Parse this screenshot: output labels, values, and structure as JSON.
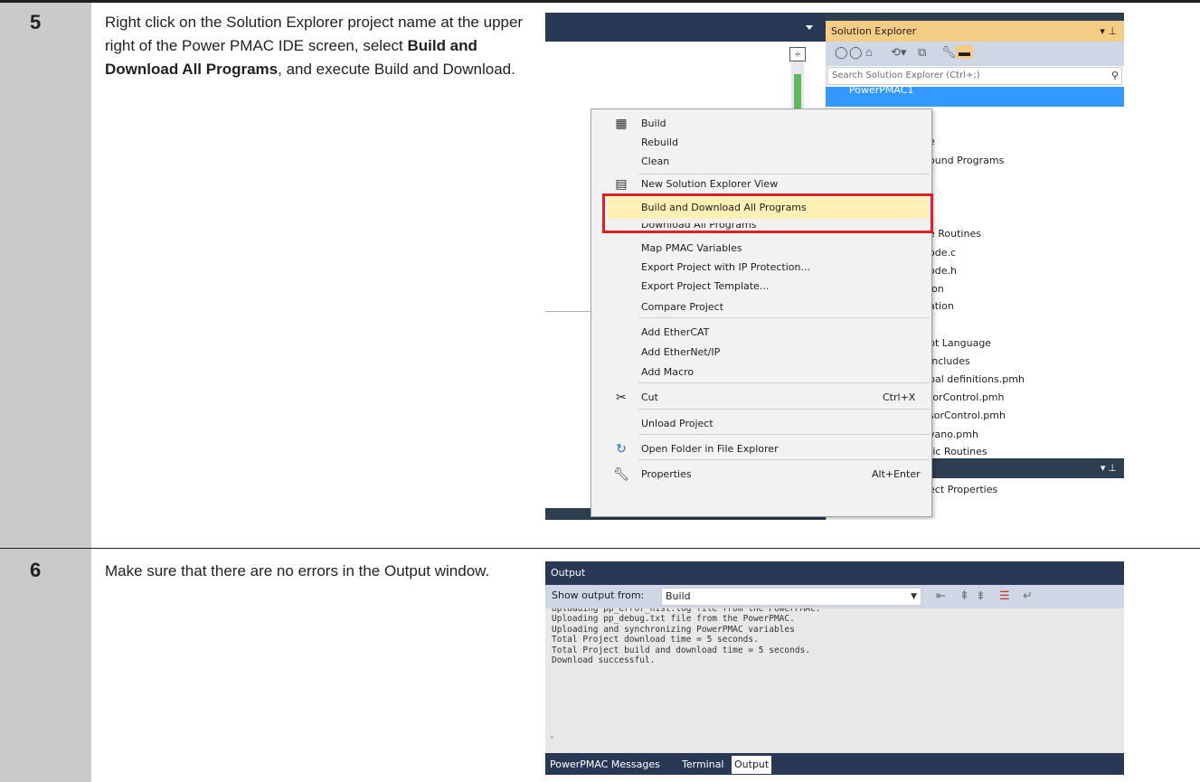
{
  "steps": [
    {
      "number": "5",
      "text_before": "Right click on the Solution Explorer project name at the upper right of the Power PMAC IDE screen, select ",
      "text_bold": "Build and Download All Programs",
      "text_after": ", and execute Build and Download."
    },
    {
      "number": "6",
      "text": "Make sure that there are no errors in the Output window."
    }
  ],
  "solution_explorer": {
    "title": "Solution Explorer",
    "search_placeholder": "Search Solution Explorer (Ctrl+;)",
    "selected_item": "PowerPMAC1",
    "items": [
      "e",
      "ound Programs",
      "s",
      "e Routines",
      "ode.c",
      "ode.h",
      "ion",
      "ation",
      "pt Language",
      "Includes",
      "bal definitions.pmh",
      "torControl.pmh",
      "sorControl.pmh",
      "vano.pmh",
      "tic Routines"
    ],
    "properties_row": "ect Properties"
  },
  "context_menu": {
    "items": [
      {
        "label": "Build",
        "icon": "build-icon"
      },
      {
        "label": "Rebuild"
      },
      {
        "label": "Clean"
      },
      {
        "label": "New Solution Explorer View",
        "icon": "new-view-icon"
      },
      {
        "label": "Build and Download All Programs",
        "highlighted": true
      },
      {
        "label": "Download All Programs"
      },
      {
        "label": "Map PMAC Variables"
      },
      {
        "label": "Export Project with IP Protection..."
      },
      {
        "label": "Export Project Template..."
      },
      {
        "label": "Compare Project"
      },
      {
        "label": "Add EtherCAT"
      },
      {
        "label": "Add EtherNet/IP"
      },
      {
        "label": "Add Macro"
      },
      {
        "label": "Cut",
        "shortcut": "Ctrl+X",
        "icon": "scissors-icon"
      },
      {
        "label": "Unload Project"
      },
      {
        "label": "Open Folder in File Explorer",
        "icon": "refresh-arrow-icon"
      },
      {
        "label": "Properties",
        "shortcut": "Alt+Enter",
        "icon": "wrench-icon"
      }
    ],
    "highlight_color": "#e02020"
  },
  "output_window": {
    "title": "Output",
    "show_output_label": "Show output from:",
    "source": "Build",
    "lines": [
      "Uploading pp_error_hist.log file from the PowerPMAC.",
      "Uploading pp_debug.txt file from the PowerPMAC.",
      "Uploading and synchronizing PowerPMAC variables",
      "Total Project download time = 5 seconds.",
      "Total Project build and download time = 5 seconds.",
      "Download successful."
    ],
    "tabs": [
      "PowerPMAC Messages",
      "Terminal",
      "Output"
    ],
    "active_tab": "Output"
  }
}
